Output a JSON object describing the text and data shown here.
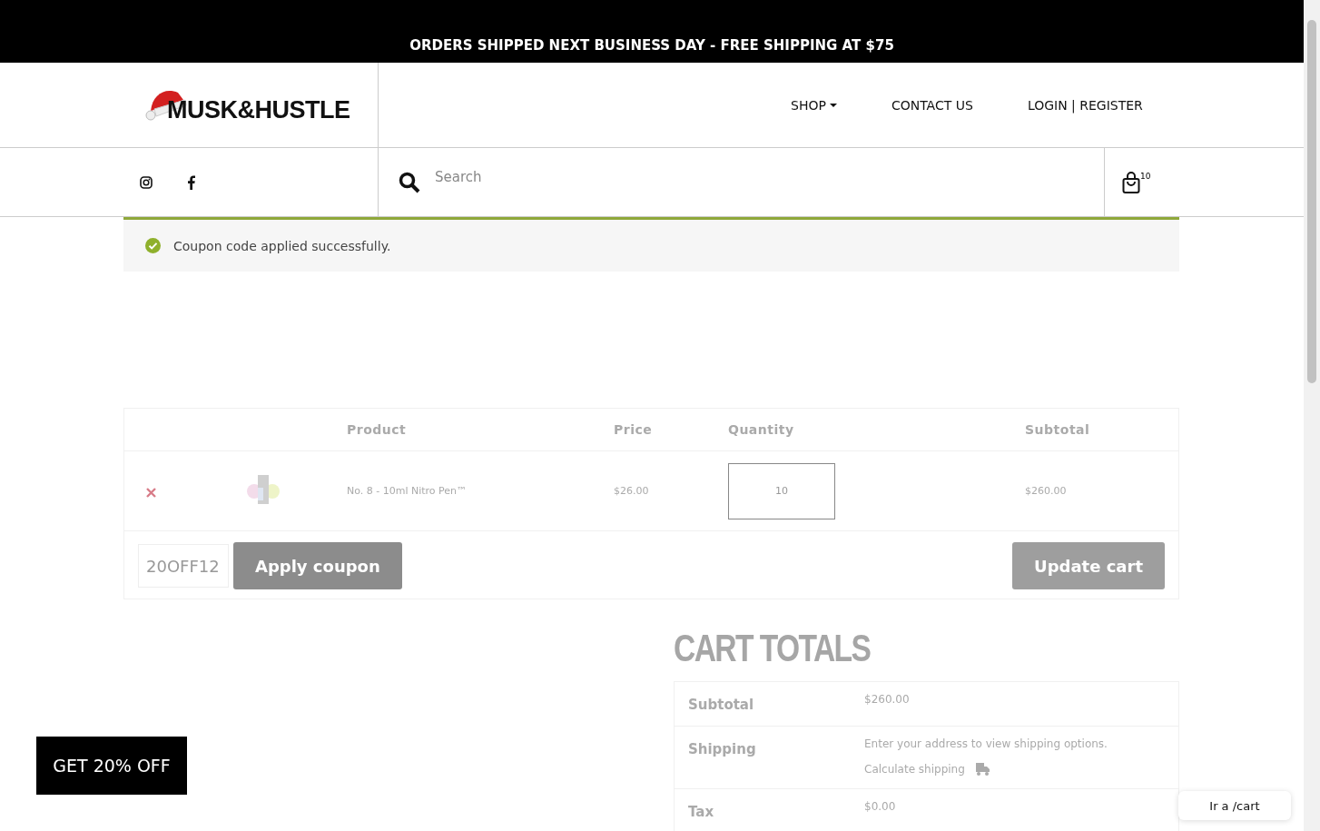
{
  "announcement": "ORDERS SHIPPED NEXT BUSINESS DAY - FREE SHIPPING AT $75",
  "logo": {
    "text": "MUSK&HUSTLE"
  },
  "nav": [
    {
      "label": "SHOP",
      "kind": "dropdown"
    },
    {
      "label": "CONTACT US",
      "kind": "link"
    },
    {
      "label": "LOGIN | REGISTER",
      "kind": "link"
    }
  ],
  "search": {
    "placeholder": "Search"
  },
  "cart_count": "10",
  "notice": "Coupon code applied successfully.",
  "cart_table": {
    "columns": [
      "Product",
      "Price",
      "Quantity",
      "Subtotal"
    ],
    "rows": [
      {
        "product": "No. 8 - 10ml Nitro Pen™",
        "price": "$26.00",
        "quantity": "10",
        "subtotal": "$260.00"
      }
    ]
  },
  "coupon": {
    "value": "20OFF12",
    "button": "Apply coupon"
  },
  "update_button": {
    "label": "Update cart",
    "disabled": true
  },
  "totals": {
    "title": "CART TOTALS",
    "rows": [
      {
        "label": "Subtotal",
        "kind": "value",
        "value": "$260.00"
      },
      {
        "label": "Shipping",
        "kind": "shipping",
        "note": "Enter your address to view shipping options.",
        "link": "Calculate shipping"
      },
      {
        "label": "Tax",
        "kind": "value",
        "value": "$0.00"
      }
    ]
  },
  "promo": "GET 20% OFF",
  "chat_tooltip": "Ir a /cart"
}
